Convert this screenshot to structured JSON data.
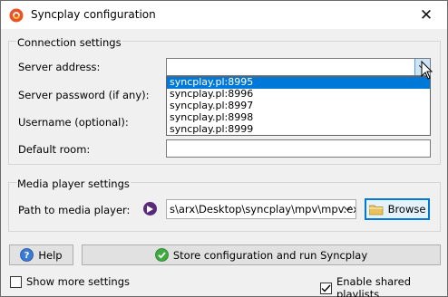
{
  "window": {
    "title": "Syncplay configuration",
    "close_glyph": "✕"
  },
  "connection": {
    "group_title": "Connection settings",
    "server_address_label": "Server address:",
    "server_address_value": "",
    "server_options": [
      "syncplay.pl:8995",
      "syncplay.pl:8996",
      "syncplay.pl:8997",
      "syncplay.pl:8998",
      "syncplay.pl:8999"
    ],
    "selected_option": "syncplay.pl:8995",
    "password_label": "Server password (if any):",
    "username_label": "Username (optional):",
    "default_room_label": "Default room:"
  },
  "media": {
    "group_title": "Media player settings",
    "path_label": "Path to media player:",
    "path_value": "s\\arx\\Desktop\\syncplay\\mpv\\mpv.exe",
    "browse_label": "Browse"
  },
  "buttons": {
    "help_label": "Help",
    "store_label": "Store configuration and run Syncplay"
  },
  "options": {
    "show_more_label": "Show more settings",
    "show_more_checked": false,
    "shared_playlists_label": "Enable shared playlists",
    "shared_playlists_checked": true
  },
  "icons": {
    "app": "syncplay-logo-icon",
    "dropdown": "chevron-down-icon",
    "media_player": "play-circle-icon",
    "browse": "folder-icon",
    "help": "help-icon",
    "store": "checkmark-icon",
    "cursor": "mouse-pointer-icon"
  },
  "colors": {
    "selection": "#0078d7",
    "focus_border": "#0078d7",
    "media_icon": "#5a2a7a"
  }
}
